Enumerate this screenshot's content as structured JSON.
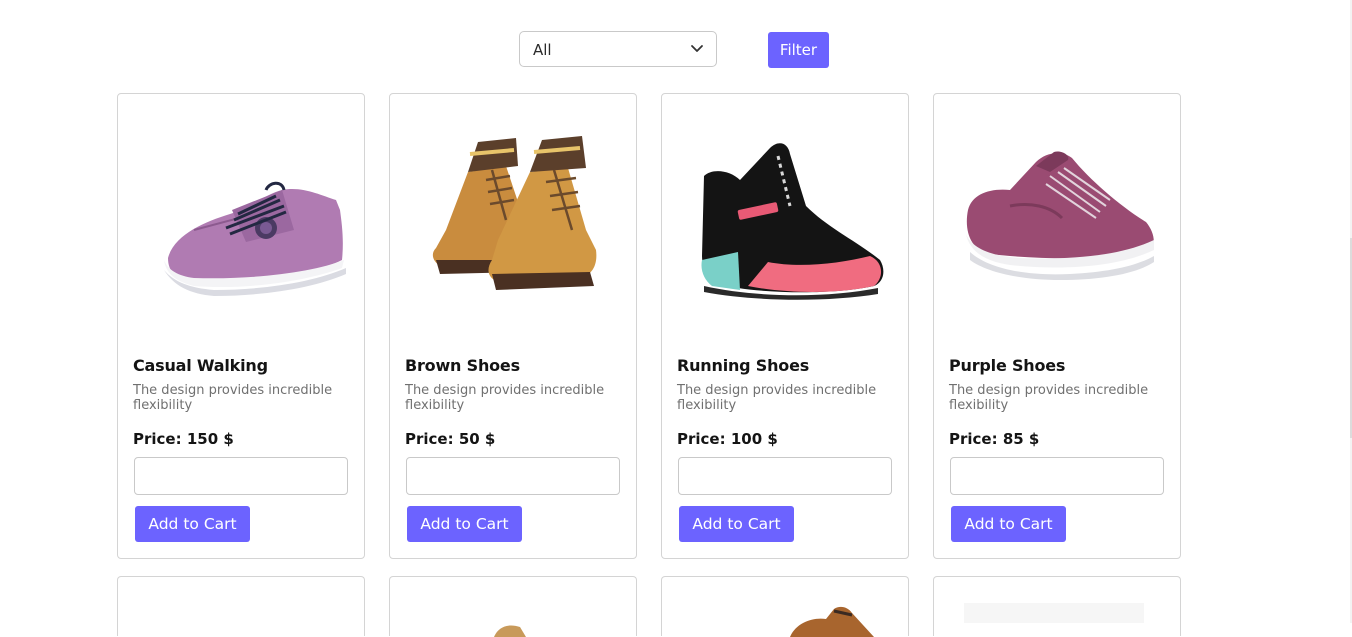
{
  "filter": {
    "selected": "All",
    "button_label": "Filter"
  },
  "products": [
    {
      "name": "Casual Walking",
      "description": "The design provides incredible flexibility",
      "price": "Price: 150 $",
      "quantity": "",
      "button_label": "Add to Cart",
      "image": "purple-knit-sneaker"
    },
    {
      "name": "Brown Shoes",
      "description": "The design provides incredible flexibility",
      "price": "Price: 50 $",
      "quantity": "",
      "button_label": "Add to Cart",
      "image": "tan-leather-boots"
    },
    {
      "name": "Running Shoes",
      "description": "The design provides incredible flexibility",
      "price": "Price: 100 $",
      "quantity": "",
      "button_label": "Add to Cart",
      "image": "black-pink-runner"
    },
    {
      "name": "Purple Shoes",
      "description": "The design provides incredible flexibility",
      "price": "Price: 85 $",
      "quantity": "",
      "button_label": "Add to Cart",
      "image": "mauve-sneaker"
    }
  ],
  "colors": {
    "accent": "#6c63ff",
    "border": "#d4d4d4"
  }
}
